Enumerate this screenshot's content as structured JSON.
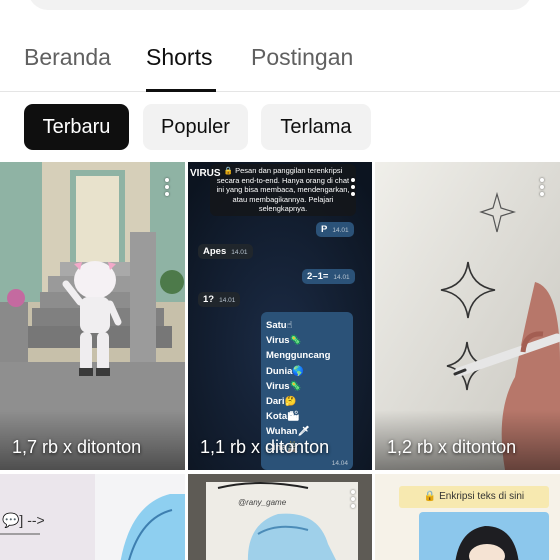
{
  "tabs": [
    {
      "label": "Beranda",
      "active": false
    },
    {
      "label": "Shorts",
      "active": true
    },
    {
      "label": "Postingan",
      "active": false
    }
  ],
  "chips": [
    {
      "label": "Terbaru",
      "active": true
    },
    {
      "label": "Populer",
      "active": false
    },
    {
      "label": "Terlama",
      "active": false
    }
  ],
  "shorts": [
    {
      "views": "1,7 rb x ditonton"
    },
    {
      "views": "1,1 rb x ditonton"
    },
    {
      "views": "1,2 rb x ditonton"
    }
  ],
  "chat": {
    "system_notice": "🔒 Pesan dan panggilan terenkripsi secara end-to-end. Hanya orang di chat ini yang bisa membaca, mendengarkan, atau membagikannya. Pelajari selengkapnya.",
    "corner_text": "VIRUS",
    "bubble_p": "P",
    "bubble_apes": "Apes",
    "bubble_21": "2–1=",
    "bubble_q": "1?",
    "time": "14.01",
    "list": [
      "Satu☝",
      "Virus🦠",
      "Mengguncang",
      "Dunia🌎",
      "Virus🦠",
      "Dari🤔",
      "Kota🏙",
      "Wuhan🗡",
      "Cina🏯"
    ],
    "list_time": "14.04"
  },
  "row2": {
    "left_text": "💬] -->",
    "mid_text": "@rany_game",
    "notice": "🔒 Enkripsi teks di sini"
  },
  "colors": {
    "accent": "#0f0f0f",
    "chip_bg": "#f2f2f2",
    "muted_text": "#606060",
    "chat_bg": "#0e1621",
    "bubble_out": "#2b5278"
  }
}
